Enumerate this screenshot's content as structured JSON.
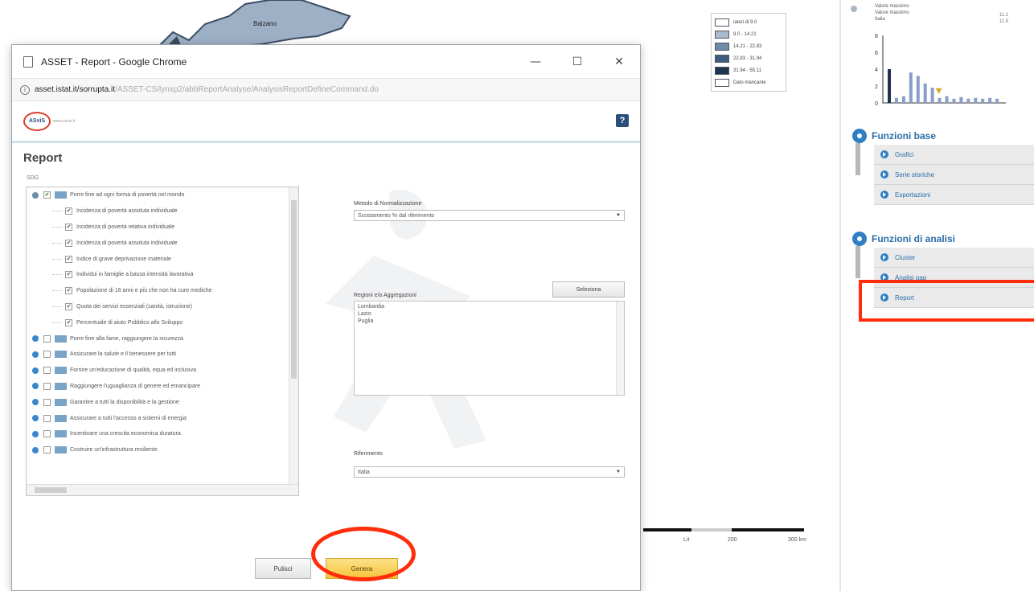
{
  "colors": {
    "accent": "#2e7fc4",
    "highlight": "#ff2d0a",
    "genera": "#f5c33a"
  },
  "map": {
    "place_label": "Balzano",
    "legend": [
      {
        "label": "lateri di 9.0",
        "color": "#ffffff"
      },
      {
        "label": "9.0 - 14.21",
        "color": "#a9bacb"
      },
      {
        "label": "14.21 - 22.83",
        "color": "#6f8aa6"
      },
      {
        "label": "22.83 - 31.94",
        "color": "#3f5c7d"
      },
      {
        "label": "31.94 - 55.11",
        "color": "#1f3450"
      },
      {
        "label": "Dato mancante",
        "color": "#ffffff"
      }
    ],
    "scale_labels": [
      "Lit",
      "200",
      "300 km"
    ]
  },
  "side_panel": {
    "header_lines": [
      "Valore massimo",
      "Valore massimo",
      "Italia"
    ],
    "header_values": [
      "11.1",
      "11.5"
    ],
    "mini_chart": {
      "type": "bar",
      "ylim": [
        0,
        8
      ],
      "yticks": [
        "8",
        "6",
        "4",
        "2",
        "0"
      ],
      "values": [
        4,
        0.6,
        0.8,
        3.6,
        3.2,
        2.3,
        1.8,
        0.6,
        0.8,
        0.5,
        0.7,
        0.5,
        0.6,
        0.5,
        0.6,
        0.5
      ],
      "marker_index": 7
    },
    "sections": [
      {
        "title": "Funzioni base",
        "items": [
          "Grafici",
          "Serie storiche",
          "Esportazioni"
        ]
      },
      {
        "title": "Funzioni di analisi",
        "items": [
          "Cluster",
          "Analisi gap",
          "Report"
        ]
      }
    ]
  },
  "popup": {
    "window_title": "ASSET - Report - Google Chrome",
    "window_controls": [
      "—",
      "☐",
      "✕"
    ],
    "url_host": "asset.istat.it/sorrupta.it",
    "url_path": "/ASSET-CS/lynxp2/abbReportAnalyse/AnalysisReportDefineCommand.do",
    "logo_text": "ASviS",
    "logo_sub": "www.asvis.it",
    "help_symbol": "?",
    "report_title": "Report",
    "goals_label": "SDG",
    "tree": [
      {
        "kind": "goal",
        "open": true,
        "checked": true,
        "label": "Porre fine ad ogni forma di povertà nel mondo"
      },
      {
        "kind": "child",
        "checked": true,
        "label": "Incidenza di povertà assoluta individuale"
      },
      {
        "kind": "child",
        "checked": true,
        "label": "Incidenza di povertà relativa individuale"
      },
      {
        "kind": "child",
        "checked": true,
        "label": "Incidenza di povertà assoluta individuale"
      },
      {
        "kind": "child",
        "checked": true,
        "label": "Indice di grave deprivazione materiale"
      },
      {
        "kind": "child",
        "checked": true,
        "label": "Individui in famiglie a bassa intensità lavorativa"
      },
      {
        "kind": "child",
        "checked": true,
        "label": "Popolazione di 16 anni e più che non ha cure mediche"
      },
      {
        "kind": "child",
        "checked": true,
        "label": "Quota dei servizi essenziali (sanità, istruzione)"
      },
      {
        "kind": "child",
        "checked": true,
        "label": "Percentuale di aiuto Pubblico allo Sviluppo"
      },
      {
        "kind": "goal",
        "open": false,
        "checked": false,
        "label": "Porre fine alla fame, raggiungere la sicurezza"
      },
      {
        "kind": "goal",
        "open": false,
        "checked": false,
        "label": "Assicurare la salute e il benessere per tutti"
      },
      {
        "kind": "goal",
        "open": false,
        "checked": false,
        "label": "Fornire un'educazione di qualità, equa ed inclusiva"
      },
      {
        "kind": "goal",
        "open": false,
        "checked": false,
        "label": "Raggiungere l'uguaglianza di genere ed emancipare"
      },
      {
        "kind": "goal",
        "open": false,
        "checked": false,
        "label": "Garantire a tutti la disponibilità e la gestione"
      },
      {
        "kind": "goal",
        "open": false,
        "checked": false,
        "label": "Assicurare a tutti l'accesso a sistemi di energia"
      },
      {
        "kind": "goal",
        "open": false,
        "checked": false,
        "label": "Incentivare una crescita economica duratura"
      },
      {
        "kind": "goal",
        "open": false,
        "checked": false,
        "label": "Costruire un'infrastruttura resiliente"
      }
    ],
    "normalization_label": "Metodo di Normalizzazione",
    "normalization_value": "Scostamento % dal riferimento",
    "select_button": "Seleziona",
    "regions_label": "Regioni e/o Aggregazioni",
    "regions": [
      "Lombardia",
      "Lazio",
      "Puglia"
    ],
    "reference_label": "Riferimento",
    "reference_value": "Italia",
    "clear_button": "Pulisci",
    "generate_button": "Genera"
  }
}
